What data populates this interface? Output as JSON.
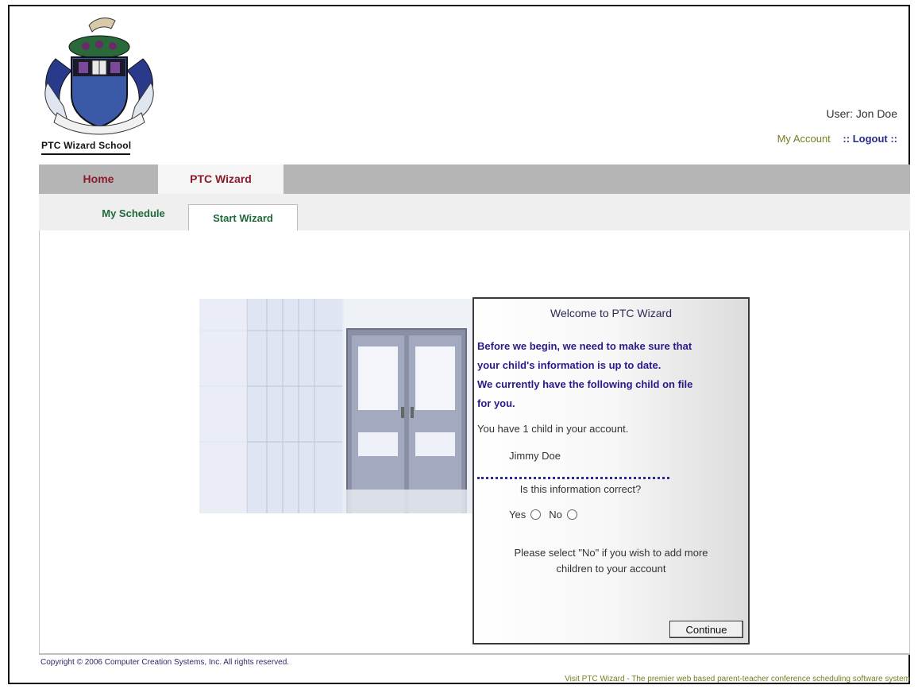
{
  "school": {
    "name": "PTC Wizard School"
  },
  "user": {
    "label": "User: Jon Doe",
    "my_account": "My Account",
    "logout": ":: Logout ::"
  },
  "main_tabs": [
    {
      "label": "Home",
      "active": false
    },
    {
      "label": "PTC Wizard",
      "active": true
    }
  ],
  "sub_tabs": [
    {
      "label": "My Schedule",
      "active": false
    },
    {
      "label": "Start Wizard",
      "active": true
    }
  ],
  "wizard": {
    "title": "Welcome to PTC Wizard",
    "intro_lines": [
      "Before we begin, we need to make sure that",
      "your child's information is up to date.",
      "We currently have the following child on file",
      "for you."
    ],
    "child_count": "You have 1 child in your account.",
    "child_name": "Jimmy Doe",
    "question": "Is this information correct?",
    "yes_label": "Yes",
    "no_label": "No",
    "note_lines": [
      "Please select \"No\" if you wish to add more",
      "children to your account"
    ],
    "continue_label": "Continue"
  },
  "footer": {
    "copyright": "Copyright © 2006 Computer Creation Systems, Inc. All rights reserved.",
    "visit": "Visit PTC Wizard - The premier web based parent-teacher conference scheduling software system"
  },
  "colors": {
    "tab_text": "#8b1a2a",
    "subtab_text": "#1e6a3a",
    "intro_text": "#2a1a8a",
    "link_olive": "#7a7a22"
  },
  "icons": [
    "school-crest-logo",
    "radio-icon"
  ]
}
